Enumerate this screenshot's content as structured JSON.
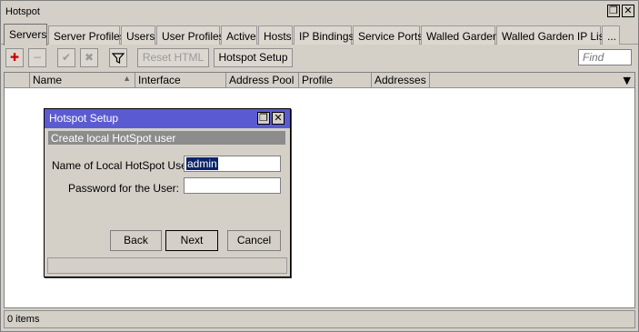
{
  "window": {
    "title": "Hotspot",
    "restore_glyph": "❐",
    "close_glyph": "✕"
  },
  "tabs": [
    {
      "label": "Servers"
    },
    {
      "label": "Server Profiles"
    },
    {
      "label": "Users"
    },
    {
      "label": "User Profiles"
    },
    {
      "label": "Active"
    },
    {
      "label": "Hosts"
    },
    {
      "label": "IP Bindings"
    },
    {
      "label": "Service Ports"
    },
    {
      "label": "Walled Garden"
    },
    {
      "label": "Walled Garden IP List"
    },
    {
      "label": "..."
    }
  ],
  "active_tab": "Servers",
  "toolbar": {
    "add_glyph": "✚",
    "remove_glyph": "−",
    "enable_glyph": "✔",
    "disable_glyph": "✖",
    "filter_glyph": "⏚",
    "reset_html_label": "Reset HTML",
    "hotspot_setup_label": "Hotspot Setup",
    "find_placeholder": "Find"
  },
  "table": {
    "columns": [
      "",
      "Name",
      "Interface",
      "Address Pool",
      "Profile",
      "Addresses ..."
    ],
    "sort_glyph": "▲",
    "menu_glyph": "▼",
    "rows": []
  },
  "status_bar": {
    "text": "0 items"
  },
  "dialog": {
    "title": "Hotspot Setup",
    "subtitle": "Create local HotSpot user",
    "username_label": "Name of Local HotSpot User:",
    "username_value": "admin",
    "password_label": "Password for the User:",
    "password_value": "",
    "back_label": "Back",
    "next_label": "Next",
    "cancel_label": "Cancel",
    "restore_glyph": "❐",
    "close_glyph": "✕"
  },
  "colors": {
    "dialog_title_bg": "#5b5bd1",
    "subtitle_bg": "#8c8c8c",
    "add_icon": "#cc0000",
    "window_bg": "#d4d0c8"
  }
}
